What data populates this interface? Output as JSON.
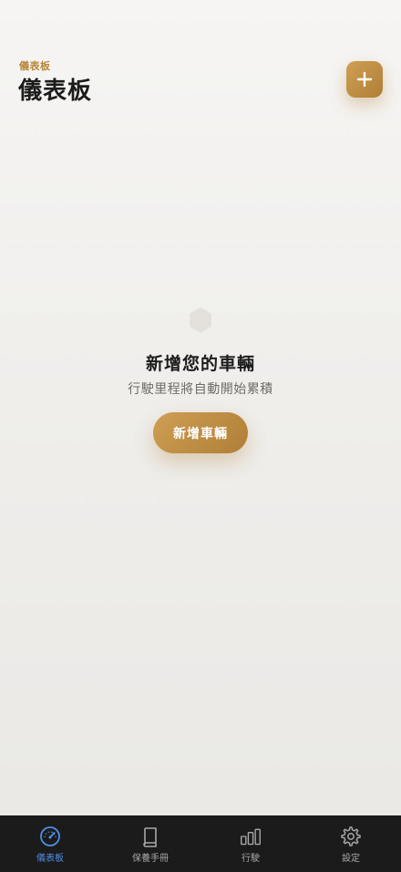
{
  "header": {
    "eyebrow": "儀表板",
    "title": "儀表板",
    "add_button_icon": "plus-icon"
  },
  "empty_state": {
    "icon": "hexagon-icon",
    "title": "新增您的車輛",
    "subtitle": "行駛里程將自動開始累積",
    "button_label": "新增車輛"
  },
  "tabbar": {
    "items": [
      {
        "label": "儀表板",
        "icon": "speedometer-icon",
        "active": true
      },
      {
        "label": "保養手冊",
        "icon": "book-icon",
        "active": false
      },
      {
        "label": "行駛",
        "icon": "bar-chart-icon",
        "active": false
      },
      {
        "label": "設定",
        "icon": "gear-icon",
        "active": false
      }
    ]
  },
  "colors": {
    "accent": "#c08e45",
    "active_tab": "#4f8fe8",
    "tabbar_bg": "#1b1b1b"
  }
}
